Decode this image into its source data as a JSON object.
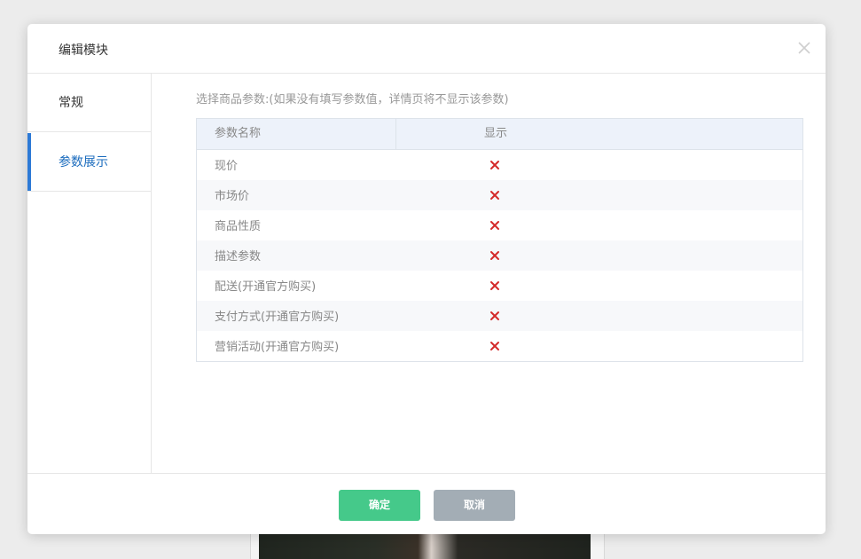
{
  "dialog": {
    "title": "编辑模块"
  },
  "sidebar": {
    "items": [
      {
        "label": "常规",
        "active": false
      },
      {
        "label": "参数展示",
        "active": true
      }
    ]
  },
  "params": {
    "hint": "选择商品参数:(如果没有填写参数值，详情页将不显示该参数)",
    "columns": [
      "参数名称",
      "显示"
    ],
    "rows": [
      {
        "name": "现价",
        "show": false
      },
      {
        "name": "市场价",
        "show": false
      },
      {
        "name": "商品性质",
        "show": false
      },
      {
        "name": "描述参数",
        "show": false
      },
      {
        "name": "配送(开通官方购买)",
        "show": false
      },
      {
        "name": "支付方式(开通官方购买)",
        "show": false
      },
      {
        "name": "营销活动(开通官方购买)",
        "show": false
      }
    ]
  },
  "footer": {
    "confirm_label": "确定",
    "cancel_label": "取消"
  },
  "colors": {
    "accent": "#2d7ad6",
    "confirm": "#45c98a",
    "cancel": "#a3adb5",
    "cross": "#d42a2a"
  }
}
